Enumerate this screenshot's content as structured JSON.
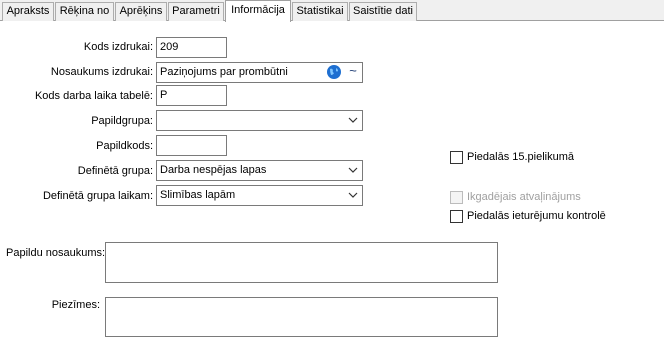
{
  "tabs": [
    {
      "label": "Apraksts",
      "active": false
    },
    {
      "label": "Rēķina no",
      "active": false
    },
    {
      "label": "Aprēķins",
      "active": false
    },
    {
      "label": "Parametri",
      "active": false
    },
    {
      "label": "Informācija",
      "active": true
    },
    {
      "label": "Statistikai",
      "active": false
    },
    {
      "label": "Saistītie dati",
      "active": false
    }
  ],
  "form": {
    "kods_izdrukai": {
      "label": "Kods izdrukai:",
      "value": "209"
    },
    "nosaukums_izdrukai": {
      "label": "Nosaukums izdrukai:",
      "value": "Paziņojums par prombūtni",
      "translate_icon": "globe-icon",
      "formula_icon": "tilde-icon"
    },
    "kods_darba_laika": {
      "label": "Kods darba laika tabelē:",
      "value": "P"
    },
    "papildgrupa": {
      "label": "Papildgrupa:",
      "value": ""
    },
    "papildkods": {
      "label": "Papildkods:",
      "value": ""
    },
    "definetagrupa": {
      "label": "Definētā grupa:",
      "value": "Darba nespējas lapas"
    },
    "definetagrupa_laikam": {
      "label": "Definētā grupa laikam:",
      "value": "Slimības lapām"
    },
    "papildu_nosaukums": {
      "label": "Papildu nosaukums:",
      "value": ""
    },
    "piezimes": {
      "label": "Piezīmes:",
      "value": ""
    }
  },
  "checkboxes": {
    "pielikums15": {
      "label": "Piedalās 15.pielikumā",
      "checked": false,
      "enabled": true
    },
    "ikgadejais": {
      "label": "Ikgadējais atvaļinājums",
      "checked": false,
      "enabled": false
    },
    "ieturejumu": {
      "label": "Piedalās ieturējumu kontrolē",
      "checked": false,
      "enabled": true
    }
  },
  "colors": {
    "accent_blue": "#1e6fd1",
    "border": "#7a7a7a",
    "panel": "#ffffff",
    "background": "#f0f0f0"
  }
}
